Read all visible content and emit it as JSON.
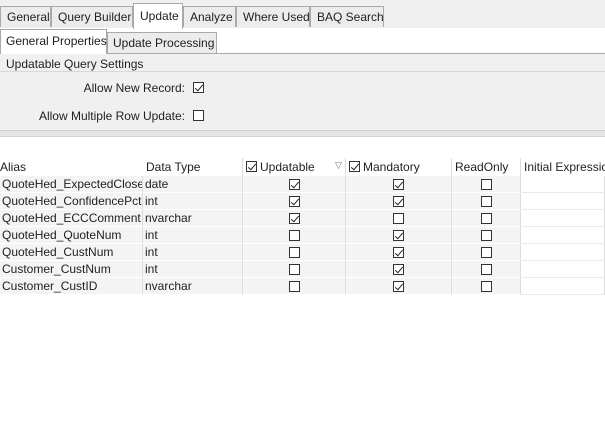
{
  "tabs": [
    {
      "label": "General"
    },
    {
      "label": "Query Builder"
    },
    {
      "label": "Update"
    },
    {
      "label": "Analyze"
    },
    {
      "label": "Where Used"
    },
    {
      "label": "BAQ Search"
    }
  ],
  "subtabs": [
    {
      "label": "General Properties"
    },
    {
      "label": "Update  Processing"
    }
  ],
  "settings": {
    "title": "Updatable Query Settings",
    "allow_new_record": {
      "label": "Allow New Record:",
      "checked": true
    },
    "allow_multiple_row_update": {
      "label": "Allow Multiple Row Update:",
      "checked": false
    }
  },
  "grid": {
    "columns": {
      "alias": "Alias",
      "data_type": "Data Type",
      "updatable": "Updatable",
      "mandatory": "Mandatory",
      "readonly": "ReadOnly",
      "initial_expression": "Initial Expressio"
    },
    "header_checks": {
      "updatable": true,
      "mandatory": true
    },
    "rows": [
      {
        "alias": "QuoteHed_ExpectedClose",
        "data_type": "date",
        "updatable": true,
        "mandatory": true,
        "readonly": false
      },
      {
        "alias": "QuoteHed_ConfidencePct",
        "data_type": "int",
        "updatable": true,
        "mandatory": true,
        "readonly": false
      },
      {
        "alias": "QuoteHed_ECCComment",
        "data_type": "nvarchar",
        "updatable": true,
        "mandatory": false,
        "readonly": false
      },
      {
        "alias": "QuoteHed_QuoteNum",
        "data_type": "int",
        "updatable": false,
        "mandatory": true,
        "readonly": false
      },
      {
        "alias": "QuoteHed_CustNum",
        "data_type": "int",
        "updatable": false,
        "mandatory": true,
        "readonly": false
      },
      {
        "alias": "Customer_CustNum",
        "data_type": "int",
        "updatable": false,
        "mandatory": true,
        "readonly": false
      },
      {
        "alias": "Customer_CustID",
        "data_type": "nvarchar",
        "updatable": false,
        "mandatory": true,
        "readonly": false
      }
    ]
  },
  "icons": {
    "filter": "filter-icon"
  }
}
